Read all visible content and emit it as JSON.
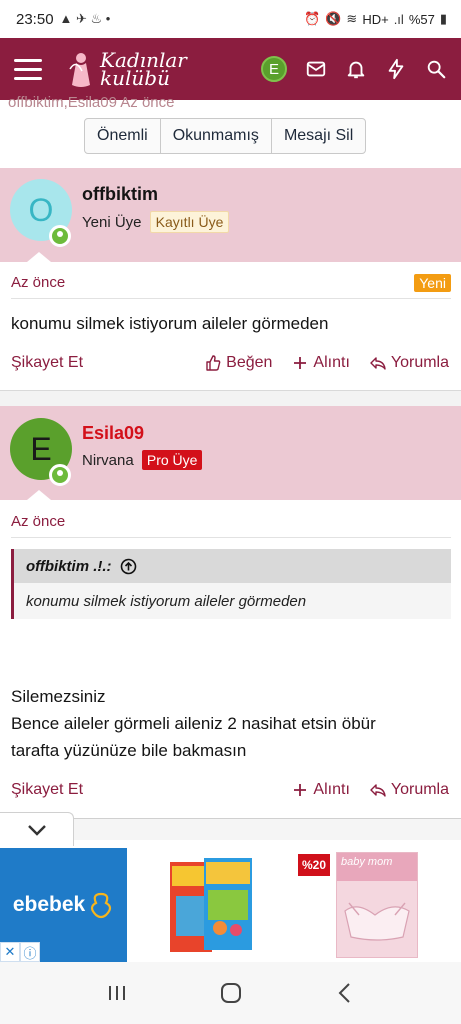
{
  "status_bar": {
    "time": "23:50",
    "battery": "%57",
    "network": "HD+"
  },
  "header": {
    "logo_line1": "Kadınlar",
    "logo_line2": "kulübü",
    "avatar_letter": "E"
  },
  "toolbar": {
    "ghost_text": "offbiktim,Esila09   Az önce",
    "buttons": [
      "Önemli",
      "Okunmamış",
      "Mesajı Sil"
    ]
  },
  "posts": [
    {
      "avatar_letter": "O",
      "avatar_color": "#a8e6ec",
      "avatar_text_color": "#38b6c4",
      "username": "offbiktim",
      "user_title": "Yeni Üye",
      "badge": "Kayıtlı Üye",
      "time": "Az önce",
      "new_label": "Yeni",
      "body": "konumu silmek istiyorum aileler görmeden",
      "actions": {
        "report": "Şikayet Et",
        "like": "Beğen",
        "quote": "Alıntı",
        "reply": "Yorumla"
      }
    },
    {
      "avatar_letter": "E",
      "avatar_color": "#5aa02c",
      "avatar_text_color": "#1a1a1a",
      "username": "Esila09",
      "user_title": "Nirvana",
      "badge": "Pro Üye",
      "time": "Az önce",
      "quote_author": "offbiktim .!.:",
      "quote_text": "konumu silmek istiyorum aileler görmeden",
      "body_line1": "Silemezsiniz",
      "body_line2": "Bence aileler görmeli aileniz 2 nasihat etsin öbür",
      "body_line3": "tarafta yüzünüze bile bakmasın",
      "actions": {
        "report": "Şikayet Et",
        "quote": "Alıntı",
        "reply": "Yorumla"
      }
    }
  ],
  "ad": {
    "brand": "ebebek",
    "discount": "%20",
    "product_label": "baby mom"
  },
  "colors": {
    "brand": "#8b1d3f",
    "user_band": "#ecc9d3",
    "pro_badge": "#d3101a",
    "new_badge": "#f39c12"
  }
}
